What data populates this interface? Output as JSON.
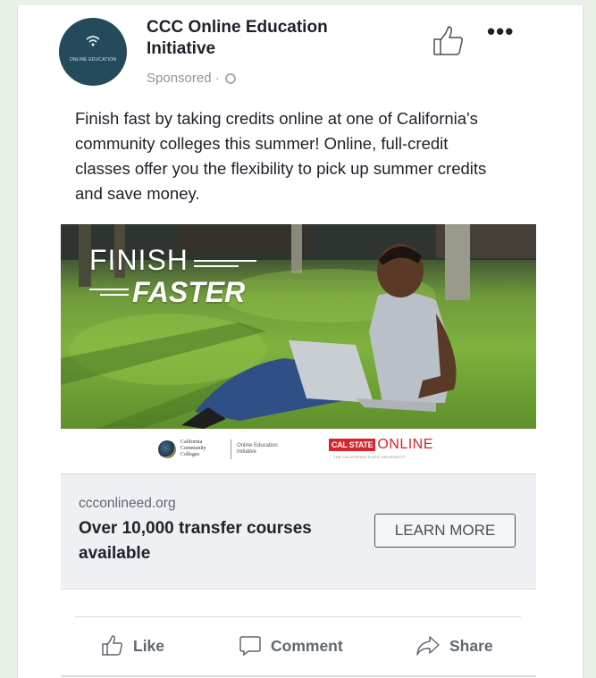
{
  "post": {
    "page_name": "CCC Online Education Initiative",
    "sponsored_label": "Sponsored ·",
    "avatar_text": "ONLINE EDUCATION",
    "body": "Finish fast by taking credits online at one of California's community colleges this summer! Online, full-credit classes offer you the flexibility to pick up summer credits and save money."
  },
  "ad_image": {
    "headline_1": "FINISH",
    "headline_2": "FASTER",
    "logo_ccc": "California Community Colleges",
    "logo_oei": "Online Education Initiative",
    "logo_calstate_box": "CAL STATE",
    "logo_calstate_online": "ONLINE",
    "logo_calstate_sub": "THE CALIFORNIA STATE UNIVERSITY"
  },
  "link": {
    "domain": "ccconlineed.org",
    "headline": "Over 10,000 transfer courses available",
    "cta": "LEARN MORE"
  },
  "actions": {
    "like": "Like",
    "comment": "Comment",
    "share": "Share"
  },
  "icons": [
    "wifi-icon",
    "globe-icon",
    "thumbs-up-icon",
    "more-icon",
    "comment-icon",
    "share-icon"
  ]
}
